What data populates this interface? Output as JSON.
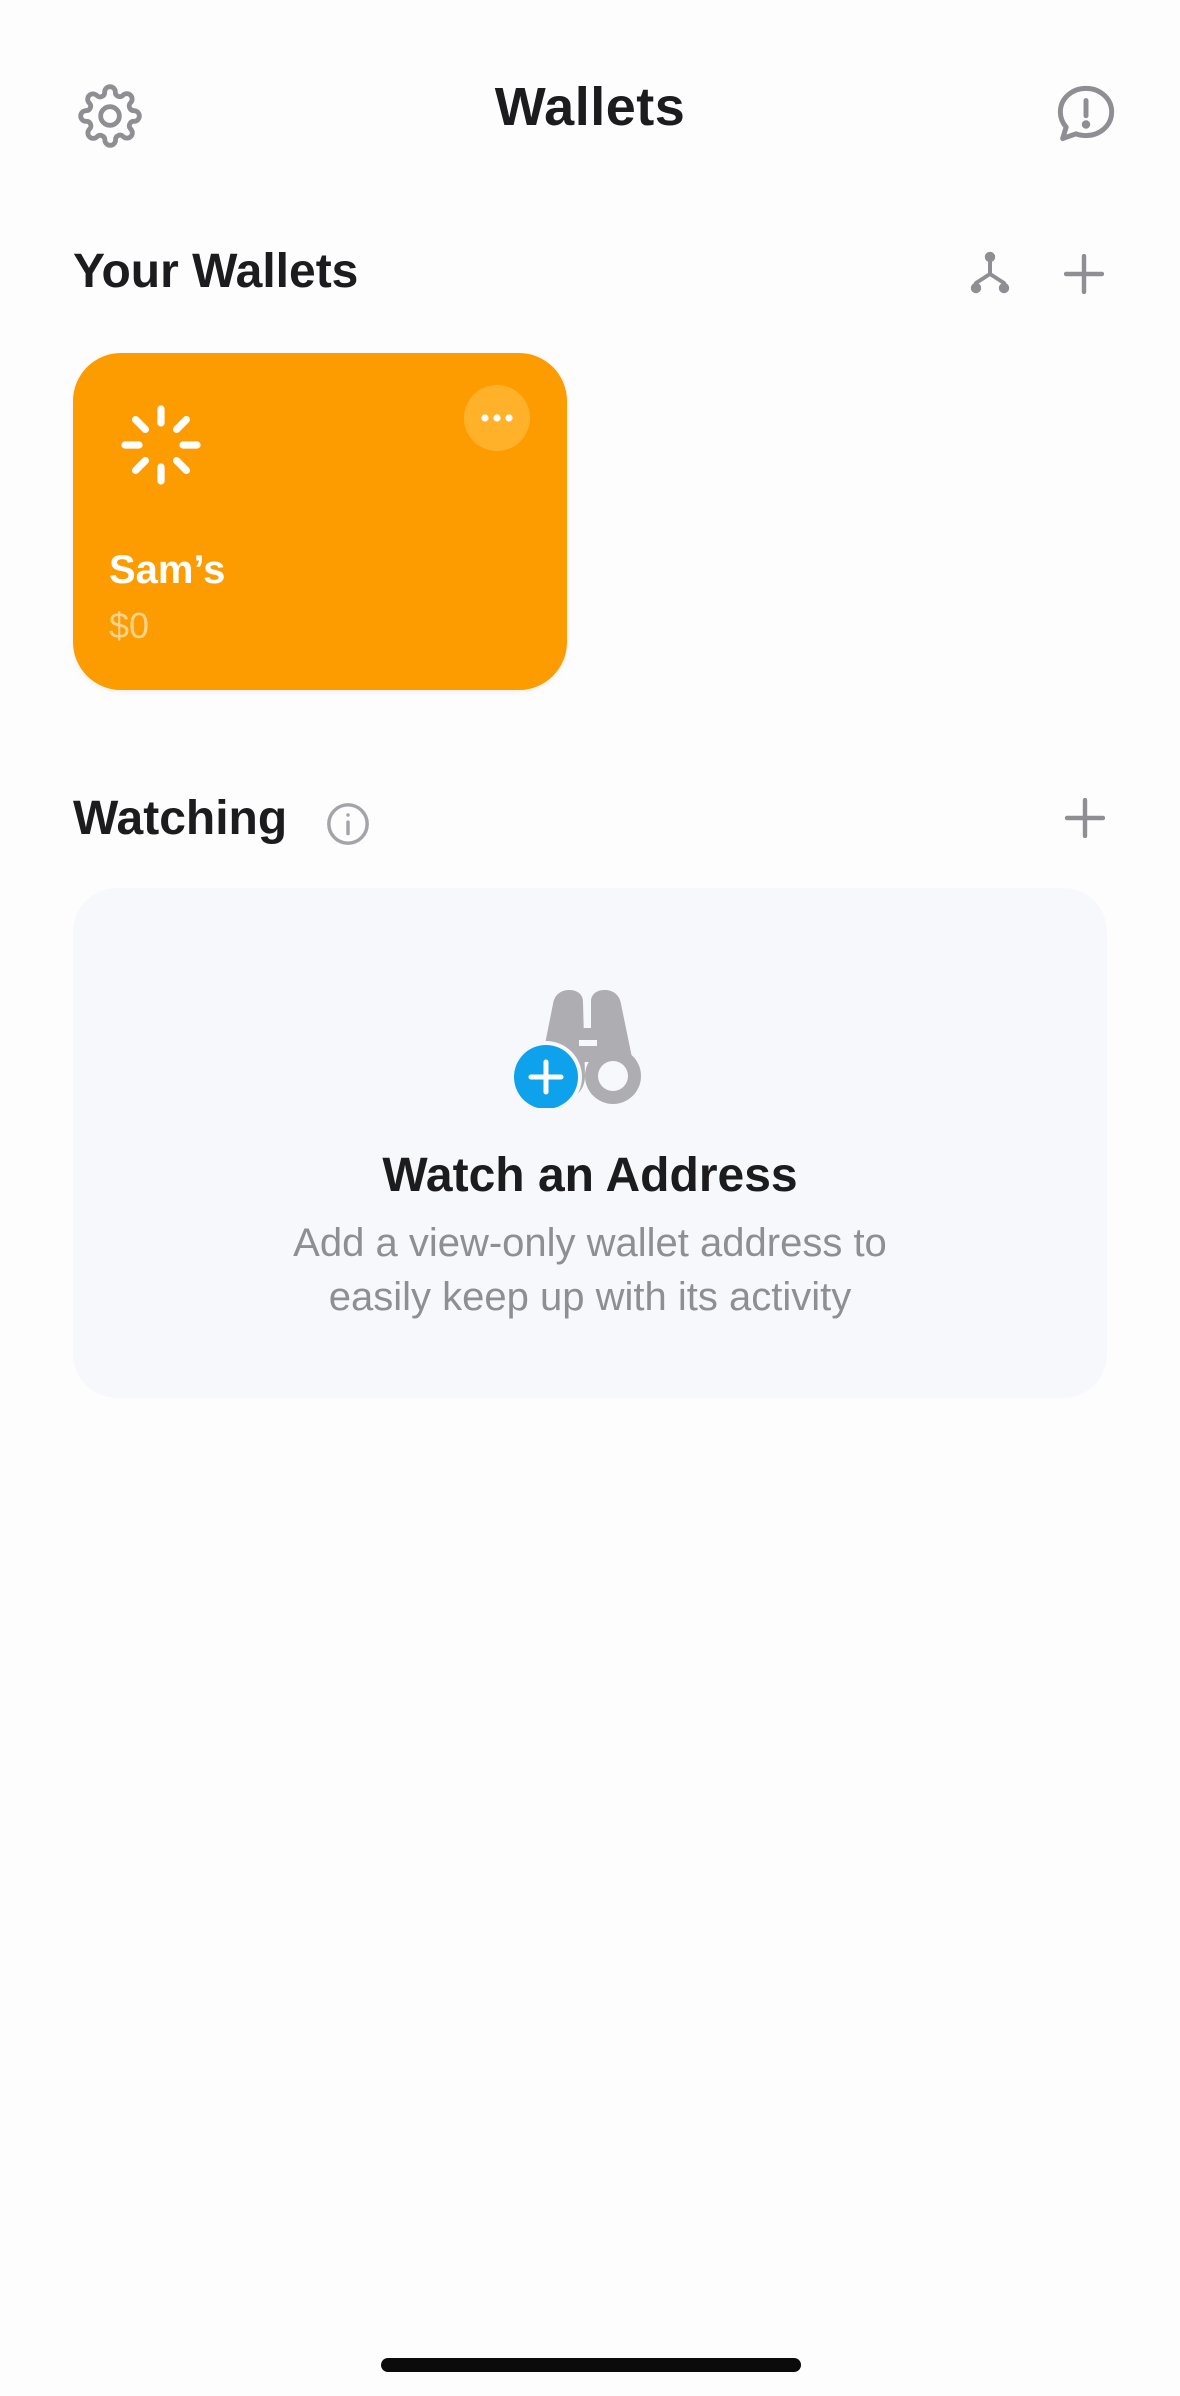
{
  "header": {
    "title": "Wallets",
    "settings_icon": "gear-icon",
    "feedback_icon": "message-alert-icon"
  },
  "your_wallets": {
    "title": "Your Wallets",
    "connect_icon": "hardware-wallet-icon",
    "add_icon": "plus-icon",
    "wallets": [
      {
        "name": "Sam’s",
        "balance": "$0",
        "status_icon": "loading-spinner-icon",
        "color": "#fd9c00"
      }
    ]
  },
  "watching": {
    "title": "Watching",
    "info_icon": "info-icon",
    "add_icon": "plus-icon",
    "empty_state": {
      "icon": "binoculars-icon",
      "title": "Watch an Address",
      "description": "Add a view-only wallet address to easily keep up with its activity"
    }
  },
  "colors": {
    "accent": "#0fa2ec",
    "wallet_orange": "#fd9c00",
    "icon_gray": "#8e8e93"
  }
}
